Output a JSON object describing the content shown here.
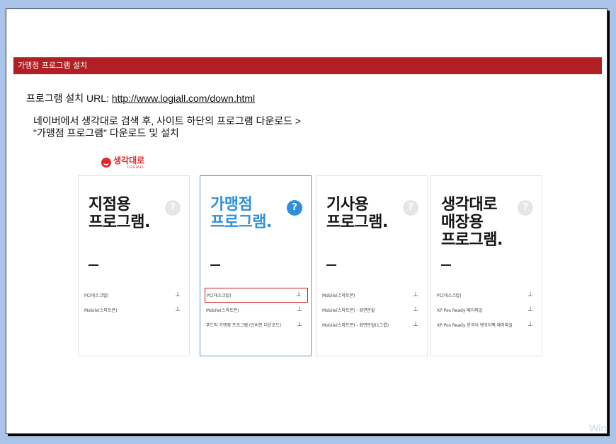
{
  "banner": {
    "title": "가맹점 프로그램 설치"
  },
  "install_line": {
    "label": "프로그램 설치 URL:",
    "url": "http://www.logiall.com/down.html"
  },
  "description": {
    "line1": "네이버에서 생각대로 검색 후, 사이트 하단의 프로그램 다운로드 >",
    "line2": "\"가맹점 프로그램\" 다운로드 및 설치"
  },
  "logo": {
    "text": "생각대로",
    "sub": "LOGIALL"
  },
  "cards": [
    {
      "title": "지점용\n프로그램.",
      "active": false,
      "downloads": [
        {
          "label": "PC(데스크탑)"
        },
        {
          "label": "Mobile(스마트폰)"
        }
      ]
    },
    {
      "title": "가맹점\n프로그램.",
      "active": true,
      "downloads": [
        {
          "label": "PC(데스크탑)",
          "highlight": true
        },
        {
          "label": "Mobile(스마트폰)"
        },
        {
          "label": "푸드릭 가맹점 프로그램 (신버전 다운로드)"
        }
      ]
    },
    {
      "title": "기사용\n프로그램.",
      "active": false,
      "downloads": [
        {
          "label": "Mobile(스마트폰)"
        },
        {
          "label": "Mobile(스마트폰) - 화면분할"
        },
        {
          "label": "Mobile(스마트폰) - 화면분할(1그룹)"
        }
      ]
    },
    {
      "title": "생각대로\n매장용\n프로그램.",
      "active": false,
      "downloads": [
        {
          "label": "PC(데스크탑)"
        },
        {
          "label": "XP Pos Ready 패치파일"
        },
        {
          "label": "XP Pos Ready 한국어 랭귀지팩 패치파일"
        }
      ]
    }
  ],
  "watermark": "Win",
  "colors": {
    "banner": "#b11e23",
    "accent": "#2f8fdc",
    "highlight": "#d0161e"
  }
}
